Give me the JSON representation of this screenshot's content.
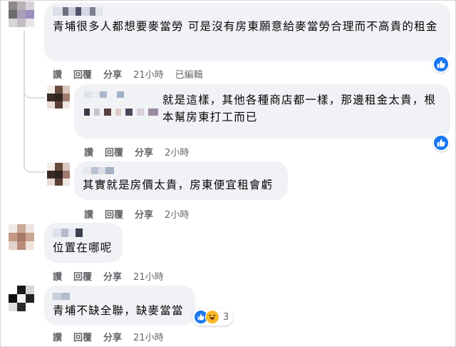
{
  "comments": [
    {
      "text": "青埔很多人都想要麥當勞 可是沒有房東願意給麥當勞合理而不高貴的租金",
      "actions": {
        "like": "讚",
        "reply": "回覆",
        "share": "分享",
        "time": "21小時",
        "edited": "已編輯"
      }
    },
    {
      "text": "就是這樣，其他各種商店都一樣，那邊租金太貴，根本幫房東打工而已",
      "actions": {
        "like": "讚",
        "reply": "回覆",
        "share": "分享",
        "time": "2小時"
      }
    },
    {
      "text": "其實就是房價太貴，房東便宜租會虧",
      "actions": {
        "like": "讚",
        "reply": "回覆",
        "share": "分享",
        "time": "2小時"
      }
    },
    {
      "text": "位置在哪呢",
      "actions": {
        "like": "讚",
        "reply": "回覆",
        "share": "分享",
        "time": "21小時"
      }
    },
    {
      "text": "青埔不缺全聯，缺麥當當",
      "reaction_count": "3",
      "actions": {
        "like": "讚",
        "reply": "回覆",
        "share": "分享",
        "time": "21小時"
      }
    }
  ],
  "colors": {
    "bubble": "#f0f2f5",
    "like_blue": "#1877f2",
    "meta_gray": "#65676b",
    "haha_yellow": "#f7b928"
  },
  "icons": {
    "like": "thumbs-up-icon",
    "haha": "laughing-face-icon"
  }
}
